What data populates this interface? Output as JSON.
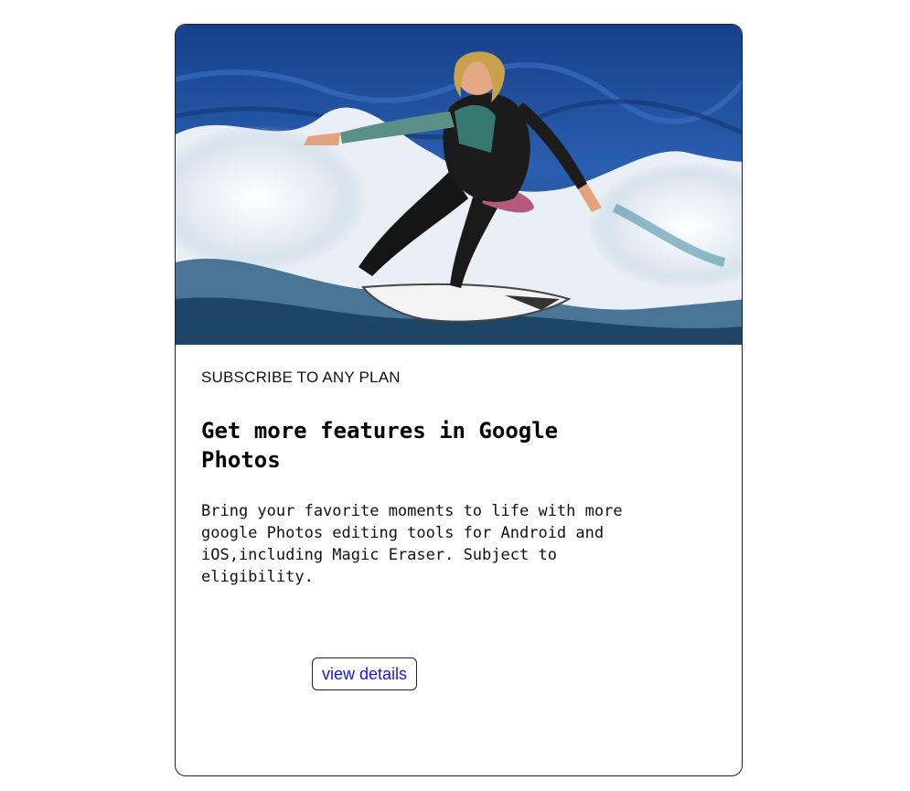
{
  "card": {
    "image_alt": "surfer riding a wave",
    "kicker": "SUBSCRIBE TO ANY PLAN",
    "title": "Get more features in Google Photos",
    "description": "Bring your favorite moments to life with more google Photos editing tools for Android and iOS,including Magic Eraser. Subject to eligibility.",
    "button_label": "view details"
  },
  "colors": {
    "link_blue": "#1a1ad8",
    "border": "#222222",
    "ocean": "#1e4f9c"
  }
}
